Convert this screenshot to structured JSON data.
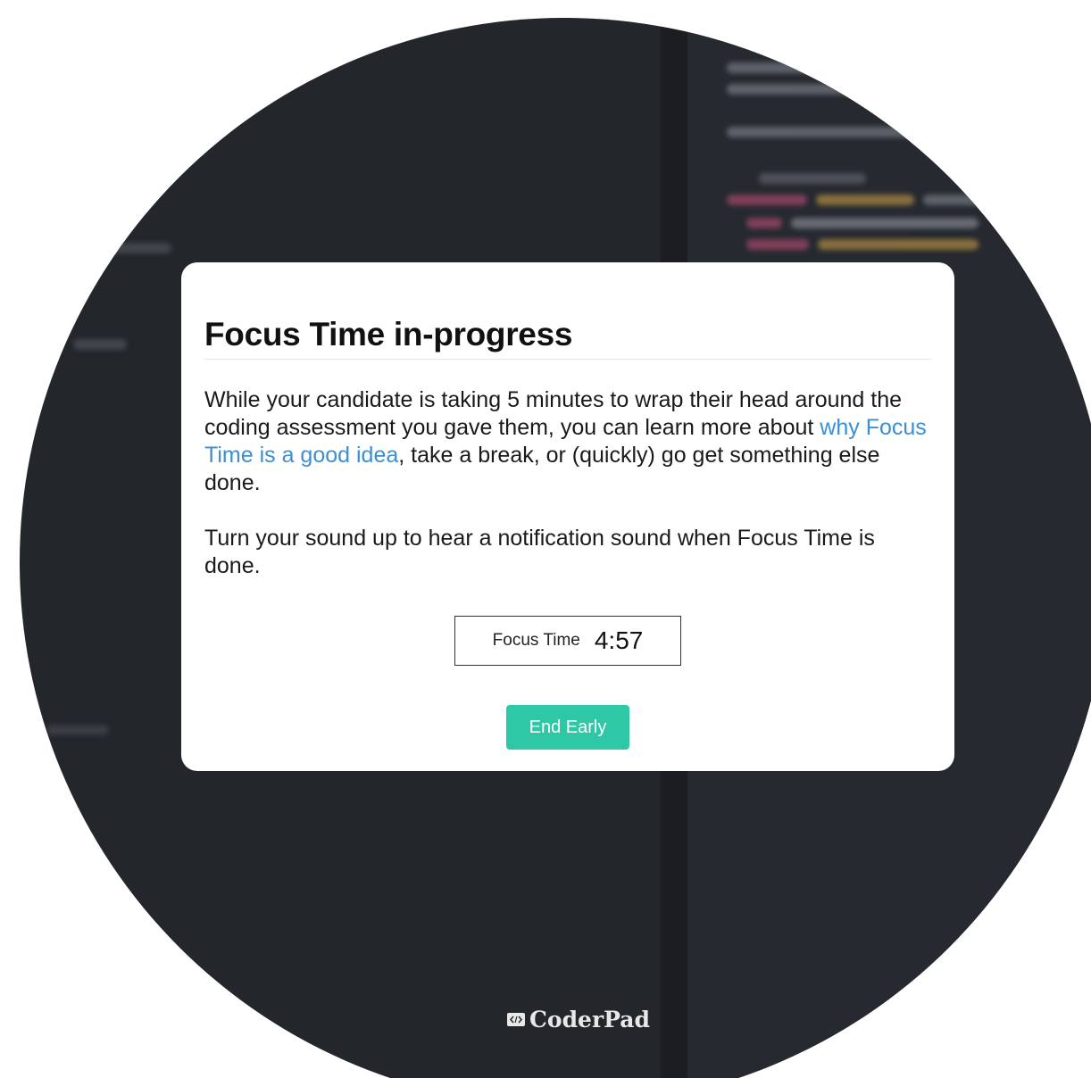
{
  "modal": {
    "title": "Focus Time in-progress",
    "paragraph1": {
      "before_link": "While your candidate is taking 5 minutes to wrap their head around the coding assessment you gave them, you can learn more about ",
      "link_text": "why Focus Time is a good idea",
      "after_link": ", take a break, or (quickly) go get something else done."
    },
    "paragraph2": "Turn your sound up to hear a notification sound when Focus Time is done.",
    "timer": {
      "label": "Focus Time",
      "value": "4:57"
    },
    "end_button_label": "End Early"
  },
  "brand": {
    "name": "CoderPad"
  },
  "colors": {
    "background_editor": "#23262b",
    "link": "#3a8fd6",
    "button": "#2ec8a6"
  }
}
